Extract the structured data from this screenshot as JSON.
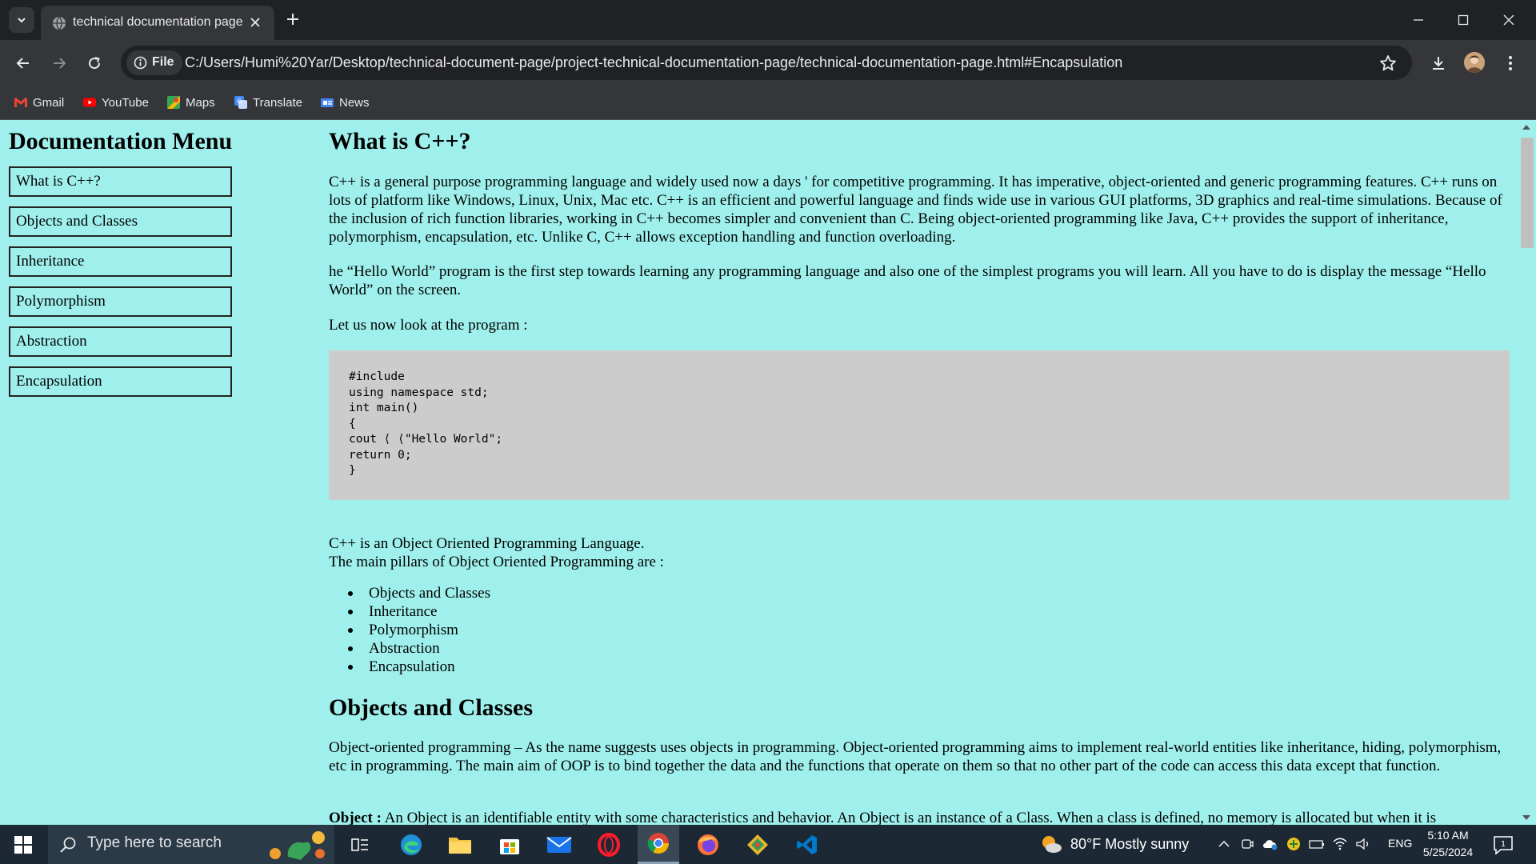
{
  "browser": {
    "tab_title": "technical documentation page",
    "url": "C:/Users/Humi%20Yar/Desktop/technical-document-page/project-technical-documentation-page/technical-documentation-page.html#Encapsulation",
    "file_label": "File",
    "bookmarks": [
      "Gmail",
      "YouTube",
      "Maps",
      "Translate",
      "News"
    ]
  },
  "page": {
    "nav_heading": "Documentation Menu",
    "nav_links": [
      "What is C++?",
      "Objects and Classes",
      "Inheritance",
      "Polymorphism",
      "Abstraction",
      "Encapsulation"
    ],
    "section1": {
      "heading": "What is C++?",
      "p1": "C++ is a general purpose programming language and widely used now a days ' for competitive programming. It has imperative, object-oriented and generic programming features. C++ runs on lots of platform like Windows, Linux, Unix, Mac etc. C++ is an efficient and powerful language and finds wide use in various GUI platforms, 3D graphics and real-time simulations. Because of the inclusion of rich function libraries, working in C++ becomes simpler and convenient than C. Being object-oriented programming like Java, C++ provides the support of inheritance, polymorphism, encapsulation, etc. Unlike C, C++ allows exception handling and function overloading.",
      "p2": "he “Hello World” program is the first step towards learning any programming language and also one of the simplest programs you will learn. All you have to do is display the message “Hello World” on the screen.",
      "p3": "Let us now look at the program :",
      "code": [
        "#include",
        "using namespace std;",
        "int main()",
        "{",
        "cout ⟨ ⟨\"Hello World\";",
        "return 0;",
        "}"
      ],
      "p4_line1": "C++ is an Object Oriented Programming Language.",
      "p4_line2": "The main pillars of Object Oriented Programming are :",
      "pillars": [
        "Objects and Classes",
        "Inheritance",
        "Polymorphism",
        "Abstraction",
        "Encapsulation"
      ]
    },
    "section2": {
      "heading": "Objects and Classes",
      "p1": "Object-oriented programming – As the name suggests uses objects in programming. Object-oriented programming aims to implement real-world entities like inheritance, hiding, polymorphism, etc in programming. The main aim of OOP is to bind together the data and the functions that operate on them so that no other part of the code can access this data except that function.",
      "p2_bold": "Object :",
      "p2_rest": " An Object is an identifiable entity with some characteristics and behavior. An Object is an instance of a Class. When a class is defined, no memory is allocated but when it is"
    }
  },
  "taskbar": {
    "search_placeholder": "Type here to search",
    "weather": "80°F  Mostly sunny",
    "lang": "ENG",
    "time": "5:10 AM",
    "date": "5/25/2024",
    "notification_count": "1"
  },
  "colors": {
    "page_background": "#9ff0ec",
    "code_background": "#cccccc"
  }
}
